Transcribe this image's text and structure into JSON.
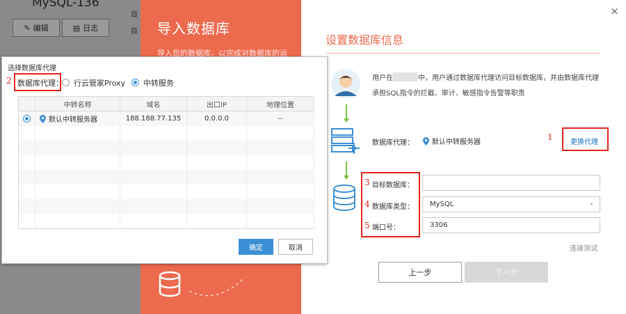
{
  "background": {
    "title": "MySQL-136",
    "edit_btn": "编辑",
    "log_btn": "日志",
    "mini1": "目",
    "mini2": "目"
  },
  "wizard": {
    "left_title": "导入数据库",
    "left_sub": "导入您的数据库，以完成对数据库的运",
    "section_title": "设置数据库信息",
    "desc_pre": "用户在",
    "desc_post": "中，用户通过数据库代理访问目标数据库，并由数据库代理承担SQL指令的拦截、审计、敏感指令告警等职责",
    "proxy_label": "数据库代理：",
    "proxy_value": "默认中转服务器",
    "change_proxy": "更换代理",
    "target_db_label": "目标数据库：",
    "target_db_value": "",
    "db_type_label": "数据库类型：",
    "db_type_value": "MySQL",
    "port_label": "端口号：",
    "port_value": "3306",
    "test_conn": "连接测试",
    "prev": "上一步",
    "next": "下一步",
    "close": "×"
  },
  "dialog": {
    "title": "选择数据库代理",
    "proxy_label": "数据库代理：",
    "option1": "行云管家Proxy",
    "option2": "中转服务",
    "selected": "中转服务",
    "columns": [
      "中转名称",
      "域名",
      "出口IP",
      "地理位置"
    ],
    "rows": [
      {
        "name": "默认中转服务器",
        "domain": "188.188.77.135",
        "ip": "0.0.0.0",
        "location": "--"
      }
    ],
    "ok": "确定",
    "cancel": "取消"
  },
  "annotations": [
    "1",
    "2",
    "3",
    "4",
    "5"
  ],
  "colors": {
    "orange": "#ec6a4e",
    "blue": "#3b8fd6",
    "annotation_red": "#e2231a",
    "green_arrow": "#7cc242"
  }
}
